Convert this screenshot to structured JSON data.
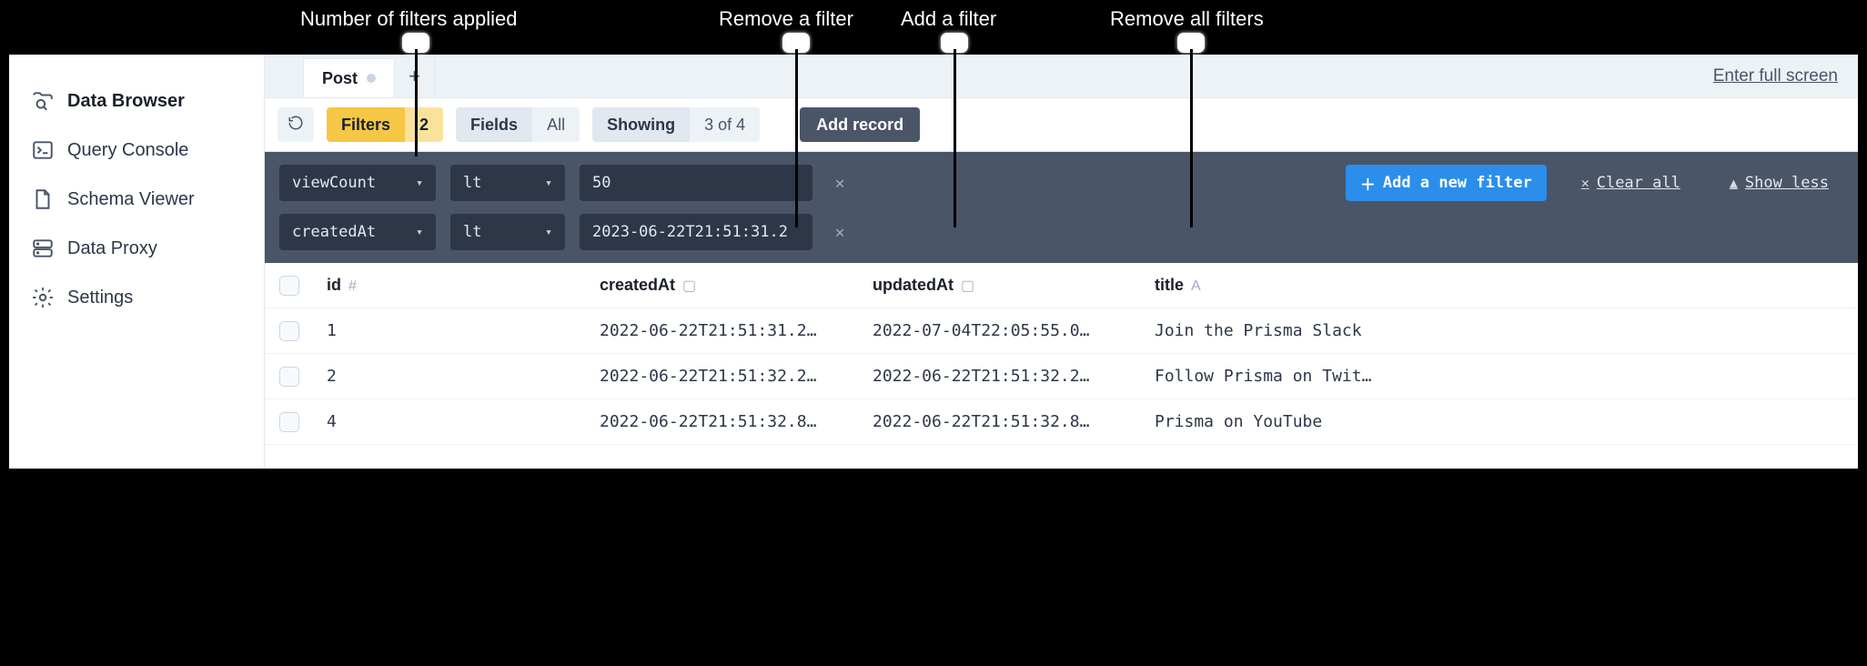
{
  "annotations": {
    "filters_count": "Number of filters applied",
    "remove_filter": "Remove a filter",
    "add_filter": "Add a filter",
    "remove_all": "Remove all filters"
  },
  "sidebar": {
    "items": [
      {
        "label": "Data Browser"
      },
      {
        "label": "Query Console"
      },
      {
        "label": "Schema Viewer"
      },
      {
        "label": "Data Proxy"
      },
      {
        "label": "Settings"
      }
    ]
  },
  "tabs": {
    "active_label": "Post",
    "enter_full_screen": "Enter full screen"
  },
  "toolbar": {
    "filters_label": "Filters",
    "filters_count": "2",
    "fields_label": "Fields",
    "fields_value": "All",
    "showing_label": "Showing",
    "showing_value": "3 of 4",
    "add_record": "Add record"
  },
  "filters": {
    "rows": [
      {
        "field": "viewCount",
        "op": "lt",
        "value": "50"
      },
      {
        "field": "createdAt",
        "op": "lt",
        "value": "2023-06-22T21:51:31.2"
      }
    ],
    "add_new": "Add a new filter",
    "clear_all": "Clear all",
    "show_less": "Show less"
  },
  "table": {
    "columns": {
      "id": "id",
      "createdAt": "createdAt",
      "updatedAt": "updatedAt",
      "title": "title"
    },
    "rows": [
      {
        "id": "1",
        "createdAt": "2022-06-22T21:51:31.2…",
        "updatedAt": "2022-07-04T22:05:55.0…",
        "title": "Join the Prisma Slack"
      },
      {
        "id": "2",
        "createdAt": "2022-06-22T21:51:32.2…",
        "updatedAt": "2022-06-22T21:51:32.2…",
        "title": "Follow Prisma on Twit…"
      },
      {
        "id": "4",
        "createdAt": "2022-06-22T21:51:32.8…",
        "updatedAt": "2022-06-22T21:51:32.8…",
        "title": "Prisma on YouTube"
      }
    ]
  }
}
